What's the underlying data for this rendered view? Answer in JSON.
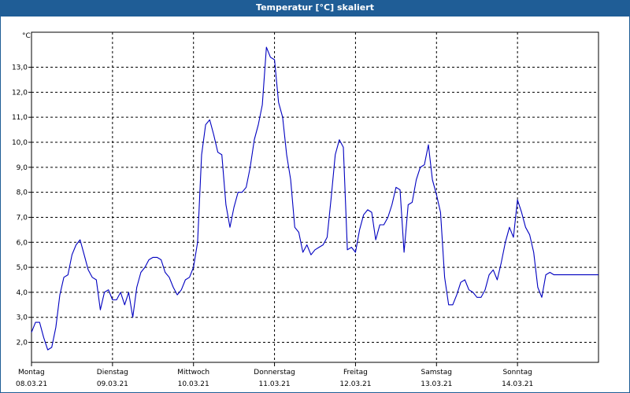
{
  "window": {
    "title": "Temperatur [°C] skaliert"
  },
  "colors": {
    "titlebar": "#1f5d96",
    "line": "#0000c0",
    "grid": "#000000"
  },
  "chart_data": {
    "type": "line",
    "title": "Temperatur [°C] skaliert",
    "ylabel": "°C",
    "xlabel": "",
    "ylim": [
      1.2,
      14.4
    ],
    "xlim": [
      0,
      7
    ],
    "grid": true,
    "y_ticks": [
      "2,0",
      "3,0",
      "4,0",
      "5,0",
      "6,0",
      "7,0",
      "8,0",
      "9,0",
      "10,0",
      "11,0",
      "12,0",
      "13,0"
    ],
    "x_ticks": [
      {
        "day": "Montag",
        "date": "08.03.21"
      },
      {
        "day": "Dienstag",
        "date": "09.03.21"
      },
      {
        "day": "Mittwoch",
        "date": "10.03.21"
      },
      {
        "day": "Donnerstag",
        "date": "11.03.21"
      },
      {
        "day": "Freitag",
        "date": "12.03.21"
      },
      {
        "day": "Samstag",
        "date": "13.03.21"
      },
      {
        "day": "Sonntag",
        "date": "14.03.21"
      }
    ],
    "series": [
      {
        "x": [
          0,
          0.05,
          0.1,
          0.15,
          0.2,
          0.25,
          0.3,
          0.35,
          0.4,
          0.45,
          0.5,
          0.55,
          0.6,
          0.65,
          0.7,
          0.75,
          0.8,
          0.85,
          0.9,
          0.95,
          1,
          1.05,
          1.1,
          1.15,
          1.2,
          1.25,
          1.3,
          1.35,
          1.4,
          1.45,
          1.5,
          1.55,
          1.6,
          1.65,
          1.7,
          1.75,
          1.8,
          1.85,
          1.9,
          1.95,
          2,
          2.05,
          2.1,
          2.15,
          2.2,
          2.25,
          2.3,
          2.35,
          2.4,
          2.45,
          2.5,
          2.55,
          2.6,
          2.65,
          2.7,
          2.75,
          2.8,
          2.85,
          2.9,
          2.95,
          3,
          3.05,
          3.1,
          3.15,
          3.2,
          3.25,
          3.3,
          3.35,
          3.4,
          3.45,
          3.5,
          3.55,
          3.6,
          3.65,
          3.7,
          3.75,
          3.8,
          3.85,
          3.9,
          3.95,
          4,
          4.05,
          4.1,
          4.15,
          4.2,
          4.25,
          4.3,
          4.35,
          4.4,
          4.45,
          4.5,
          4.55,
          4.6,
          4.65,
          4.7,
          4.75,
          4.8,
          4.85,
          4.9,
          4.95,
          5,
          5.05,
          5.1,
          5.15,
          5.2,
          5.25,
          5.3,
          5.35,
          5.4,
          5.45,
          5.5,
          5.55,
          5.6,
          5.65,
          5.7,
          5.75,
          5.8,
          5.85,
          5.9,
          5.95,
          6,
          6.05,
          6.1,
          6.15,
          6.2,
          6.25,
          6.3,
          6.35,
          6.4,
          6.45,
          6.5,
          6.55,
          6.6,
          6.65,
          6.7,
          6.75,
          6.8,
          6.85,
          6.9,
          6.95,
          7
        ],
        "y": [
          2.4,
          2.8,
          2.8,
          2.2,
          1.7,
          1.8,
          2.6,
          3.9,
          4.6,
          4.7,
          5.5,
          5.9,
          6.1,
          5.5,
          4.9,
          4.6,
          4.5,
          3.3,
          4.0,
          4.1,
          3.7,
          3.7,
          4.0,
          3.5,
          4.0,
          3.0,
          4.2,
          4.8,
          5.0,
          5.3,
          5.4,
          5.4,
          5.3,
          4.8,
          4.6,
          4.2,
          3.9,
          4.1,
          4.5,
          4.6,
          5.0,
          6.0,
          9.5,
          10.7,
          10.9,
          10.3,
          9.6,
          9.5,
          7.5,
          6.6,
          7.4,
          8.0,
          8.0,
          8.2,
          9.0,
          10.1,
          10.7,
          11.5,
          13.8,
          13.4,
          13.3,
          11.6,
          11.0,
          9.5,
          8.5,
          6.6,
          6.4,
          5.6,
          5.9,
          5.5,
          5.7,
          5.8,
          5.9,
          6.2,
          7.8,
          9.5,
          10.1,
          9.8,
          5.7,
          5.8,
          5.6,
          6.5,
          7.1,
          7.3,
          7.2,
          6.1,
          6.7,
          6.7,
          7.0,
          7.5,
          8.2,
          8.1,
          5.6,
          7.5,
          7.6,
          8.5,
          9.0,
          9.1,
          9.9,
          8.5,
          7.9,
          7.2,
          4.6,
          3.5,
          3.5,
          3.9,
          4.4,
          4.5,
          4.1,
          4.0,
          3.8,
          3.8,
          4.1,
          4.7,
          4.9,
          4.5,
          5.2,
          6.0,
          6.6,
          6.2,
          7.7,
          7.2,
          6.6,
          6.3,
          5.6,
          4.2,
          3.8,
          4.7,
          4.8,
          4.7,
          4.7,
          4.7,
          4.7,
          4.7,
          4.7,
          4.7,
          4.7,
          4.7,
          4.7,
          4.7,
          4.7
        ]
      }
    ]
  }
}
